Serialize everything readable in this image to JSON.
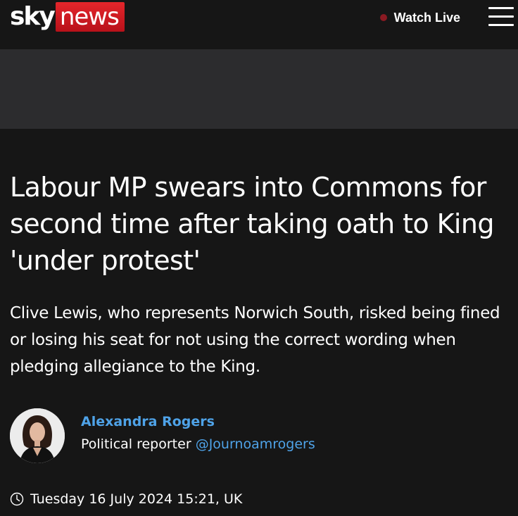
{
  "header": {
    "logo_sky": "sky",
    "logo_news": "news",
    "watch_live_label": "Watch Live",
    "menu_icon": "hamburger-menu-icon",
    "live_dot_color": "#8a1a22",
    "brand_red": "#d4141c"
  },
  "article": {
    "headline": "Labour MP swears into Commons for second time after taking oath to King 'under protest'",
    "standfirst": "Clive Lewis, who represents Norwich South, risked being fined or losing his seat for not using the correct wording when pledging allegiance to the King.",
    "author": {
      "name": "Alexandra Rogers",
      "role": "Political reporter",
      "handle": "@Journoamrogers"
    },
    "date": "Tuesday 16 July 2024 15:21, UK",
    "date_icon": "clock-icon"
  },
  "colors": {
    "background": "#161616",
    "ad_band": "#2c2c2e",
    "link": "#4fa3e8"
  }
}
